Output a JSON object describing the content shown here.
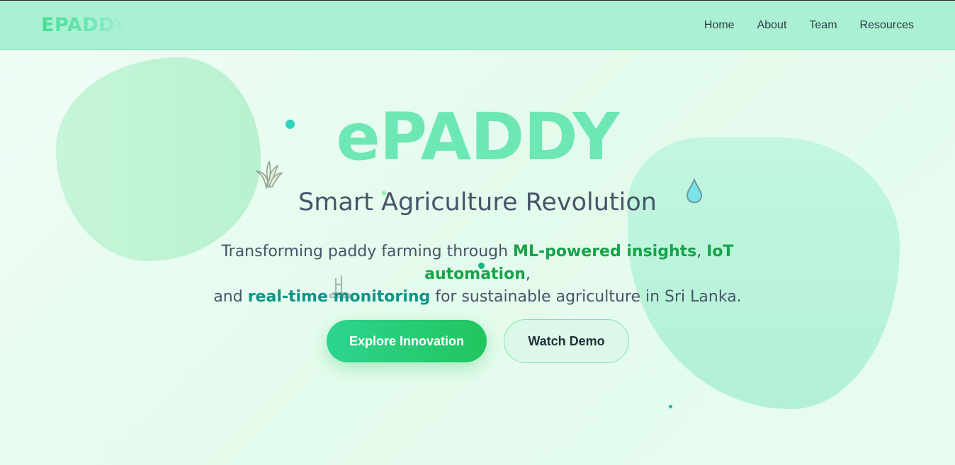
{
  "nav": {
    "logo": "EPADDY",
    "links": [
      "Home",
      "About",
      "Team",
      "Resources"
    ]
  },
  "hero": {
    "title": "ePADDY",
    "subtitle": "Smart Agriculture Revolution",
    "desc_part1": "Transforming paddy farming through ",
    "highlight1": "ML-powered insights",
    "sep1": ", ",
    "highlight2": "IoT automation",
    "sep2": ",",
    "desc_part2": "and ",
    "highlight3": "real-time monitoring",
    "desc_part3": " for sustainable agriculture in Sri Lanka.",
    "primary_button": "Explore Innovation",
    "secondary_button": "Watch Demo"
  },
  "icons": [
    "rice-plant-icon",
    "water-drop-icon",
    "tractor-icon"
  ],
  "colors": {
    "navbar": "#aaf0d2",
    "title": "#6ee7b7",
    "highlight_green": "#16a34a",
    "highlight_teal": "#0d9488",
    "button_primary": "#22c55e"
  }
}
